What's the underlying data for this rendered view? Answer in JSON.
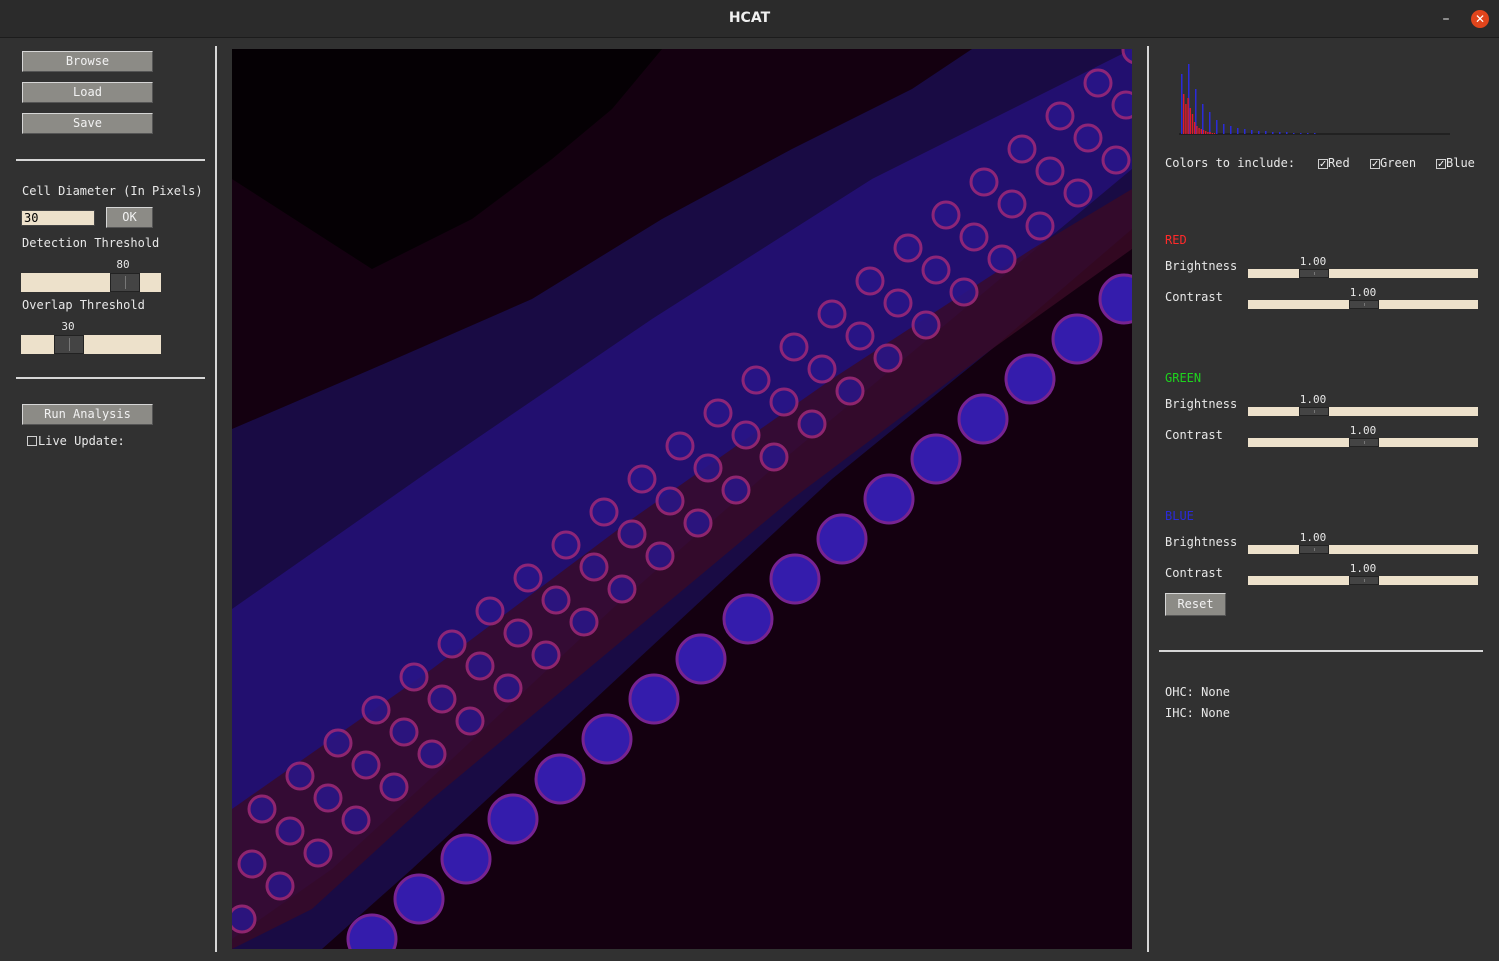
{
  "window": {
    "title": "HCAT",
    "minimize_label": "–",
    "close_label": "✕"
  },
  "left_panel": {
    "browse_label": "Browse",
    "load_label": "Load",
    "save_label": "Save",
    "cell_diameter_label": "Cell Diameter (In Pixels)",
    "cell_diameter_value": "30",
    "ok_label": "OK",
    "detection_threshold_label": "Detection Threshold",
    "detection_threshold_value": "80",
    "detection_threshold_level": 0.8,
    "overlap_threshold_label": "Overlap Threshold",
    "overlap_threshold_value": "30",
    "overlap_threshold_level": 0.3,
    "run_analysis_label": "Run Analysis",
    "live_update_label": "Live Update:",
    "live_update_checked": false
  },
  "right_panel": {
    "colors_label": "Colors to include:",
    "colors": [
      {
        "label": "Red",
        "checked": true
      },
      {
        "label": "Green",
        "checked": true
      },
      {
        "label": "Blue",
        "checked": true
      }
    ],
    "channels": {
      "red": {
        "title": "RED",
        "color": "#ff2a2a",
        "brightness_label": "Brightness",
        "brightness_value": "1.00",
        "contrast_label": "Contrast",
        "contrast_value": "1.00"
      },
      "green": {
        "title": "GREEN",
        "color": "#1ed31e",
        "brightness_label": "Brightness",
        "brightness_value": "1.00",
        "contrast_label": "Contrast",
        "contrast_value": "1.00"
      },
      "blue": {
        "title": "BLUE",
        "color": "#2a2ad9",
        "brightness_label": "Brightness",
        "brightness_value": "1.00",
        "contrast_label": "Contrast",
        "contrast_value": "1.00"
      }
    },
    "reset_label": "Reset",
    "ohc_text": "OHC: None",
    "ihc_text": "IHC: None"
  }
}
